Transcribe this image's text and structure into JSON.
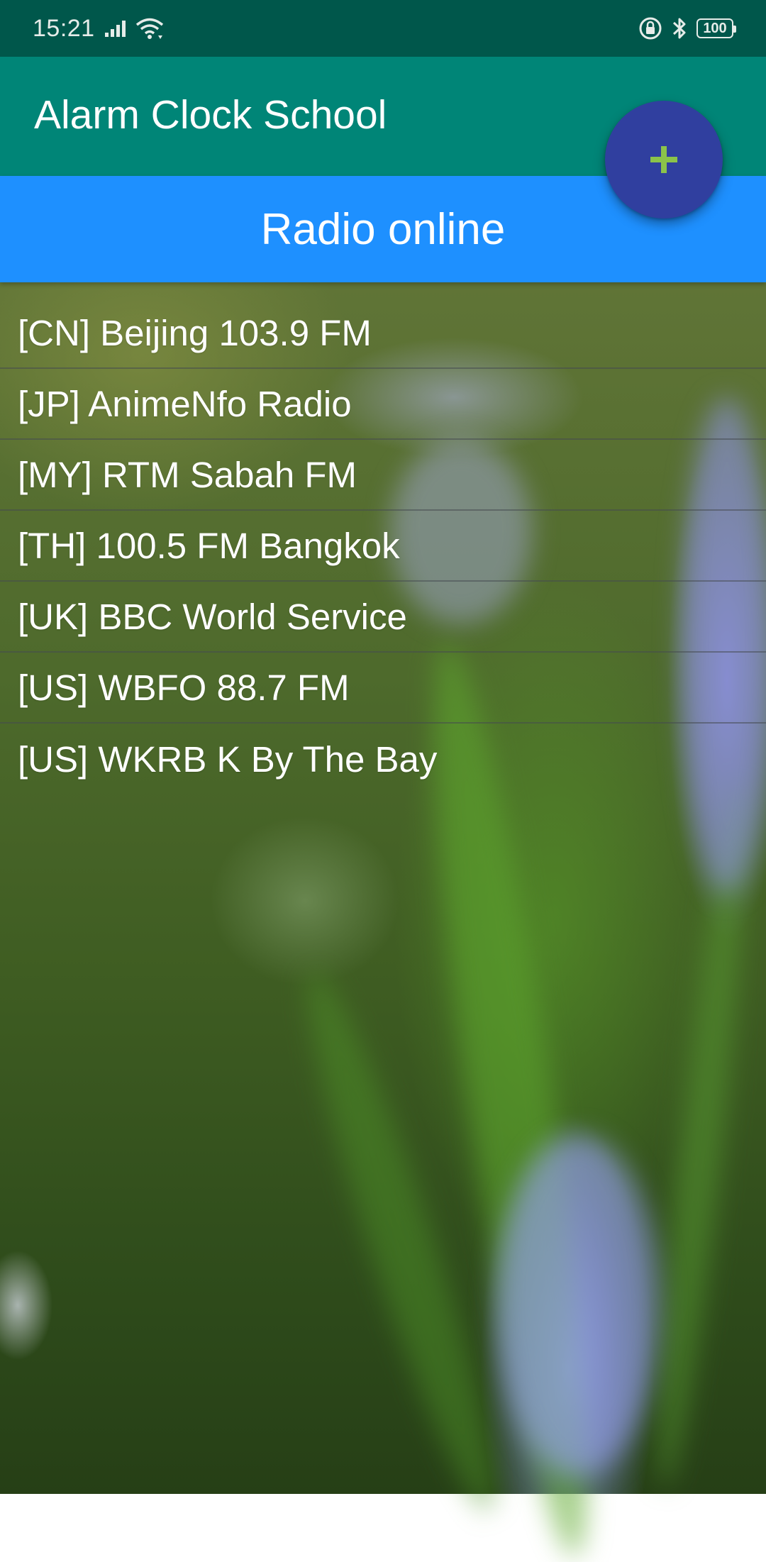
{
  "status_bar": {
    "time": "15:21",
    "battery": "100",
    "icons": [
      "signal-icon",
      "wifi-icon",
      "rotation-lock-icon",
      "bluetooth-icon",
      "battery-icon"
    ]
  },
  "app_bar": {
    "title": "Alarm Clock School",
    "background_color": "#008577"
  },
  "header": {
    "title": "Radio online",
    "background_color": "#1e90ff"
  },
  "fab": {
    "icon": "plus-icon",
    "background_color": "#303f9f",
    "icon_color": "#8bc34a"
  },
  "stations": [
    {
      "label": "[CN] Beijing 103.9 FM"
    },
    {
      "label": "[JP] AnimeNfo Radio"
    },
    {
      "label": "[MY] RTM Sabah FM"
    },
    {
      "label": "[TH] 100.5 FM Bangkok"
    },
    {
      "label": "[UK] BBC World Service"
    },
    {
      "label": "[US] WBFO 88.7 FM"
    },
    {
      "label": "[US] WKRB K By The Bay"
    }
  ]
}
